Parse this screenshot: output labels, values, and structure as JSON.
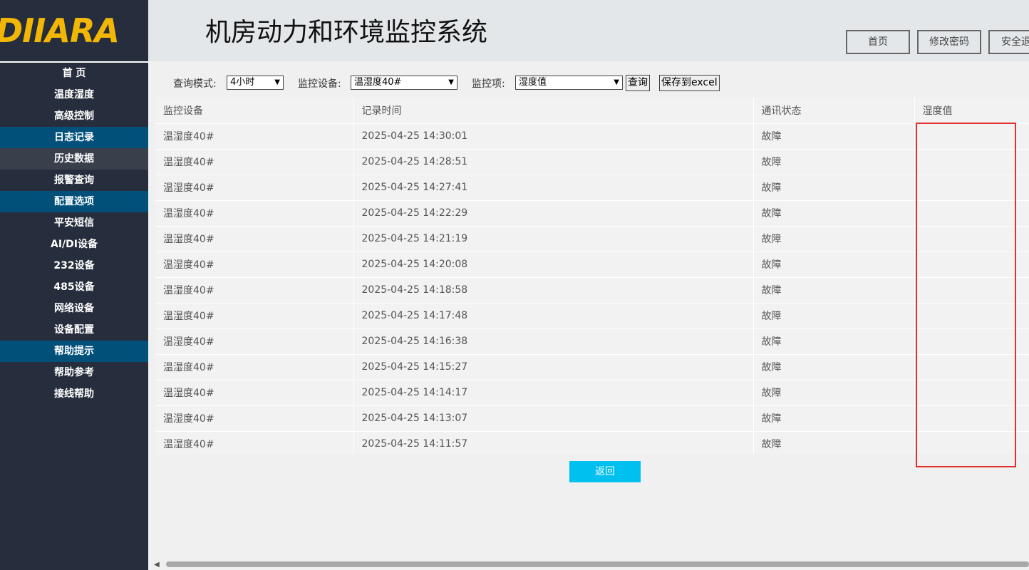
{
  "logo": {
    "text": "DIIARA"
  },
  "header": {
    "title": "机房动力和环境监控系统",
    "buttons": {
      "home": "首页",
      "change_password": "修改密码",
      "logout": "安全退"
    }
  },
  "sidebar": {
    "items": [
      {
        "label": "首 页",
        "type": "item"
      },
      {
        "label": "温度湿度",
        "type": "item"
      },
      {
        "label": "高级控制",
        "type": "item"
      },
      {
        "label": "日志记录",
        "type": "section"
      },
      {
        "label": "历史数据",
        "type": "active"
      },
      {
        "label": "报警查询",
        "type": "item"
      },
      {
        "label": "配置选项",
        "type": "section"
      },
      {
        "label": "平安短信",
        "type": "item"
      },
      {
        "label": "AI/DI设备",
        "type": "item"
      },
      {
        "label": "232设备",
        "type": "item"
      },
      {
        "label": "485设备",
        "type": "item"
      },
      {
        "label": "网络设备",
        "type": "item"
      },
      {
        "label": "设备配置",
        "type": "item"
      },
      {
        "label": "帮助提示",
        "type": "section"
      },
      {
        "label": "帮助参考",
        "type": "item"
      },
      {
        "label": "接线帮助",
        "type": "item"
      }
    ]
  },
  "filters": {
    "mode_label": "查询模式:",
    "mode_value": "4小时",
    "device_label": "监控设备:",
    "device_value": "温湿度40#",
    "item_label": "监控项:",
    "item_value": "湿度值",
    "query_button": "查询",
    "export_button": "保存到excel"
  },
  "table": {
    "headers": [
      "监控设备",
      "记录时间",
      "通讯状态",
      "湿度值"
    ],
    "rows": [
      [
        "温湿度40#",
        "2025-04-25 14:30:01",
        "故障",
        ""
      ],
      [
        "温湿度40#",
        "2025-04-25 14:28:51",
        "故障",
        ""
      ],
      [
        "温湿度40#",
        "2025-04-25 14:27:41",
        "故障",
        ""
      ],
      [
        "温湿度40#",
        "2025-04-25 14:22:29",
        "故障",
        ""
      ],
      [
        "温湿度40#",
        "2025-04-25 14:21:19",
        "故障",
        ""
      ],
      [
        "温湿度40#",
        "2025-04-25 14:20:08",
        "故障",
        ""
      ],
      [
        "温湿度40#",
        "2025-04-25 14:18:58",
        "故障",
        ""
      ],
      [
        "温湿度40#",
        "2025-04-25 14:17:48",
        "故障",
        ""
      ],
      [
        "温湿度40#",
        "2025-04-25 14:16:38",
        "故障",
        ""
      ],
      [
        "温湿度40#",
        "2025-04-25 14:15:27",
        "故障",
        ""
      ],
      [
        "温湿度40#",
        "2025-04-25 14:14:17",
        "故障",
        ""
      ],
      [
        "温湿度40#",
        "2025-04-25 14:13:07",
        "故障",
        ""
      ],
      [
        "温湿度40#",
        "2025-04-25 14:11:57",
        "故障",
        ""
      ]
    ]
  },
  "back_button": "返回",
  "colors": {
    "sidebar_bg": "#262d3c",
    "section_bg": "#00507a",
    "logo": "#f2b705",
    "accent": "#00c0f0",
    "highlight": "#e03030"
  }
}
